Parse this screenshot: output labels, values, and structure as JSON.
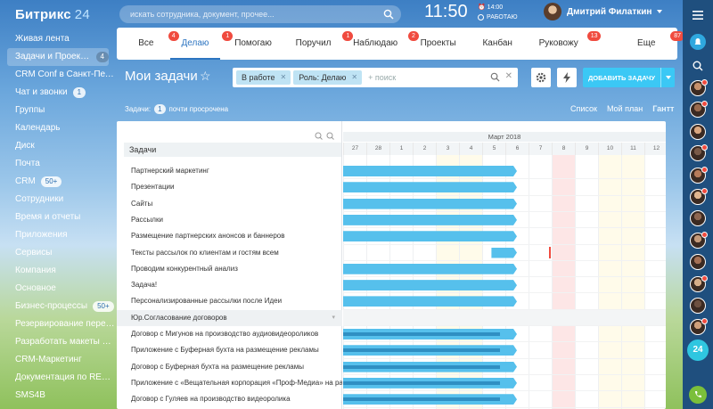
{
  "app": {
    "logo_name": "Битрикс",
    "logo_num": "24"
  },
  "header": {
    "search_placeholder": "искать сотрудника, документ, прочее...",
    "clock": "11:50",
    "alarm": "14:00",
    "work_status": "РАБОТАЮ",
    "user_name": "Дмитрий Филаткин"
  },
  "sidebar": {
    "items": [
      {
        "label": "Живая лента",
        "badge": ""
      },
      {
        "label": "Задачи и Проекты",
        "badge": "4",
        "active": true
      },
      {
        "label": "CRM Conf в Санкт-Петер...",
        "badge": ""
      },
      {
        "label": "Чат и звонки",
        "badge": "1"
      },
      {
        "label": "Группы",
        "badge": ""
      },
      {
        "label": "Календарь",
        "badge": ""
      },
      {
        "label": "Диск",
        "badge": ""
      },
      {
        "label": "Почта",
        "badge": ""
      },
      {
        "label": "CRM",
        "badge": "50+"
      },
      {
        "label": "Сотрудники",
        "badge": ""
      },
      {
        "label": "Время и отчеты",
        "badge": ""
      },
      {
        "label": "Приложения",
        "badge": ""
      },
      {
        "label": "Сервисы",
        "badge": ""
      },
      {
        "label": "Компания",
        "badge": ""
      },
      {
        "label": "Основное",
        "badge": ""
      },
      {
        "label": "Бизнес-процессы",
        "badge": "50+"
      },
      {
        "label": "Резервирование перего...",
        "badge": ""
      },
      {
        "label": "Разработать макеты для ...",
        "badge": ""
      },
      {
        "label": "CRM-Маркетинг",
        "badge": ""
      },
      {
        "label": "Документация по REST API",
        "badge": ""
      },
      {
        "label": "SMS4B",
        "badge": ""
      }
    ]
  },
  "tabs": [
    {
      "label": "Все",
      "count": "4"
    },
    {
      "label": "Делаю",
      "count": "1",
      "active": true
    },
    {
      "label": "Помогаю",
      "count": ""
    },
    {
      "label": "Поручил",
      "count": "1"
    },
    {
      "label": "Наблюдаю",
      "count": "2"
    },
    {
      "label": "Проекты",
      "count": ""
    },
    {
      "label": "Канбан",
      "count": ""
    },
    {
      "label": "Руковожу",
      "count": "13"
    },
    {
      "label": "Еще",
      "count": "87"
    }
  ],
  "toolbar": {
    "page_title": "Мои задачи",
    "chip1": "В работе",
    "chip2": "Роль: Делаю",
    "filter_placeholder": "+ поиск",
    "add_task": "ДОБАВИТЬ ЗАДАЧУ"
  },
  "summary": {
    "label": "Задачи:",
    "count": "1",
    "text": "почти просрочена"
  },
  "views": [
    "Список",
    "Мой план",
    "Гантт"
  ],
  "gantt": {
    "left_title": "Задачи",
    "month": "Март 2018",
    "days": [
      "27",
      "28",
      "1",
      "2",
      "3",
      "4",
      "5",
      "6",
      "7",
      "8",
      "9",
      "10",
      "11",
      "12"
    ],
    "weekend_indexes": [
      4,
      5,
      11,
      12
    ],
    "today_index": 9,
    "tasks": [
      {
        "name": "Партнерский маркетинг",
        "start": 0,
        "end": 7.5,
        "progress": 0
      },
      {
        "name": "Презентации",
        "start": 0,
        "end": 7.5,
        "progress": 0
      },
      {
        "name": "Сайты",
        "start": 0,
        "end": 7.5,
        "progress": 0
      },
      {
        "name": "Рассылки",
        "start": 0,
        "end": 7.5,
        "progress": 0
      },
      {
        "name": "Размещение партнерских анонсов и баннеров",
        "start": 0,
        "end": 7.5,
        "progress": 0
      },
      {
        "name": "Тексты рассылок по клиентам и гостям всем",
        "start": 6.4,
        "end": 7.5,
        "progress": 0,
        "marker": 8.9
      },
      {
        "name": "Проводим конкурентный анализ",
        "start": 0,
        "end": 7.5,
        "progress": 0
      },
      {
        "name": "Задача!",
        "start": 0,
        "end": 7.5,
        "progress": 0
      },
      {
        "name": "Персонализированные рассылки после Идеи",
        "start": 0,
        "end": 7.5,
        "progress": 0
      },
      {
        "name": "Юр.Согласование договоров",
        "group": true
      },
      {
        "name": "Договор с Мигунов на производство аудиовидеороликов",
        "start": 0,
        "end": 7.5,
        "progress": 0.9
      },
      {
        "name": "Приложение с Буферная бухта на размещение рекламы",
        "start": 0,
        "end": 7.5,
        "progress": 0.9
      },
      {
        "name": "Договор с Буферная бухта на размещение рекламы",
        "start": 0,
        "end": 7.5,
        "progress": 0.9
      },
      {
        "name": "Приложение с «Вещательная корпорация «Проф-Медиа» на размещ...",
        "start": 0,
        "end": 7.5,
        "progress": 0.9
      },
      {
        "name": "Договор с Гуляев на производство видеоролика",
        "start": 0,
        "end": 7.5,
        "progress": 0.9
      }
    ]
  },
  "rightbar": {
    "counter": "24"
  },
  "colors": {
    "accent": "#2d75c1",
    "bar": "#56c0ec",
    "badge": "#f04b3f",
    "add_button": "#3bc8f5"
  }
}
